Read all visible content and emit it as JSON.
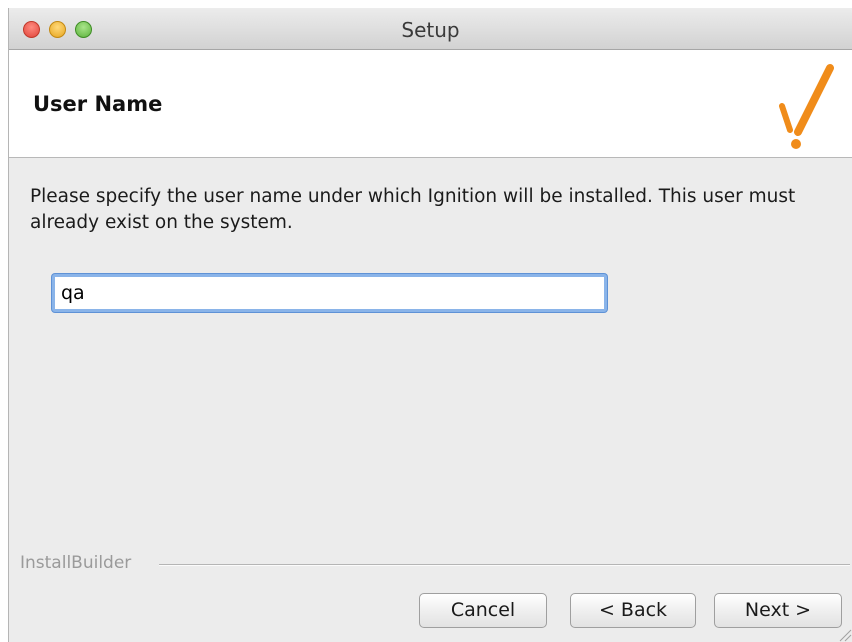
{
  "window": {
    "title": "Setup"
  },
  "header": {
    "page_title": "User Name",
    "logo_icon": "bitrock-check-exclamation-icon",
    "logo_color": "#f08c1a"
  },
  "main": {
    "instructions": "Please specify the user name under which Ignition will be installed. This user must already exist on the system.",
    "username_input": {
      "value": "qa",
      "placeholder": ""
    }
  },
  "footer": {
    "builder_label": "InstallBuilder",
    "cancel_label": "Cancel",
    "back_label": "< Back",
    "next_label": "Next >"
  },
  "colors": {
    "field_focus": "#8ab4e9",
    "window_bg": "#ececec"
  }
}
